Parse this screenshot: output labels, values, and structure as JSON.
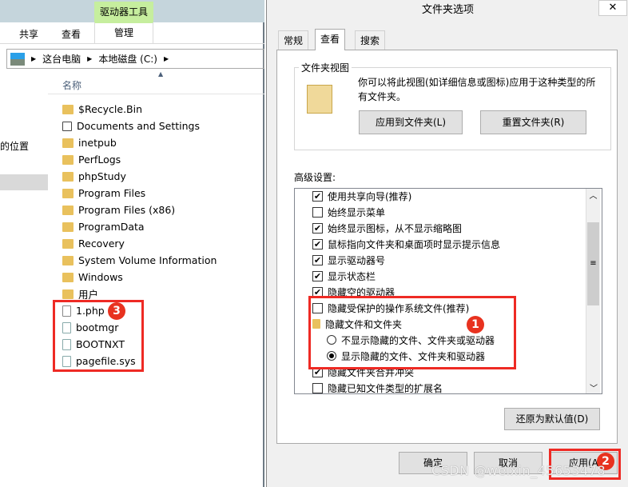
{
  "explorer": {
    "context_tab": "驱动器工具",
    "ribbon_tabs": [
      "共享",
      "查看",
      "管理"
    ],
    "breadcrumb": [
      "这台电脑",
      "本地磁盘 (C:)"
    ],
    "column_header": "名称",
    "nav_item": "的位置",
    "files": [
      {
        "name": "$Recycle.Bin",
        "icon": "folder-icon"
      },
      {
        "name": "Documents and Settings",
        "icon": "shortcut-folder-icon"
      },
      {
        "name": "inetpub",
        "icon": "folder-icon"
      },
      {
        "name": "PerfLogs",
        "icon": "folder-icon"
      },
      {
        "name": "phpStudy",
        "icon": "folder-icon"
      },
      {
        "name": "Program Files",
        "icon": "folder-icon"
      },
      {
        "name": "Program Files (x86)",
        "icon": "folder-icon"
      },
      {
        "name": "ProgramData",
        "icon": "folder-icon"
      },
      {
        "name": "Recovery",
        "icon": "folder-icon"
      },
      {
        "name": "System Volume Information",
        "icon": "folder-icon"
      },
      {
        "name": "Windows",
        "icon": "folder-icon"
      },
      {
        "name": "用户",
        "icon": "folder-icon"
      },
      {
        "name": "1.php",
        "icon": "file-icon"
      },
      {
        "name": "bootmgr",
        "icon": "system-file-icon"
      },
      {
        "name": "BOOTNXT",
        "icon": "system-file-icon"
      },
      {
        "name": "pagefile.sys",
        "icon": "system-file-icon"
      }
    ],
    "badge": "3"
  },
  "dialog": {
    "title": "文件夹选项",
    "close": "✕",
    "tabs": [
      "常规",
      "查看",
      "搜索"
    ],
    "active_tab": "查看",
    "folder_views": {
      "label": "文件夹视图",
      "description": "你可以将此视图(如详细信息或图标)应用于这种类型的所有文件夹。",
      "apply_button": "应用到文件夹(L)",
      "reset_button": "重置文件夹(R)"
    },
    "advanced_label": "高级设置:",
    "options": [
      {
        "type": "checkbox",
        "label": "使用共享向导(推荐)",
        "checked": true
      },
      {
        "type": "checkbox",
        "label": "始终显示菜单",
        "checked": false
      },
      {
        "type": "checkbox",
        "label": "始终显示图标，从不显示缩略图",
        "checked": true
      },
      {
        "type": "checkbox",
        "label": "鼠标指向文件夹和桌面项时显示提示信息",
        "checked": true
      },
      {
        "type": "checkbox",
        "label": "显示驱动器号",
        "checked": true
      },
      {
        "type": "checkbox",
        "label": "显示状态栏",
        "checked": true
      },
      {
        "type": "checkbox",
        "label": "隐藏空的驱动器",
        "checked": true
      },
      {
        "type": "checkbox",
        "label": "隐藏受保护的操作系统文件(推荐)",
        "checked": false
      },
      {
        "type": "group",
        "label": "隐藏文件和文件夹"
      },
      {
        "type": "radio",
        "label": "不显示隐藏的文件、文件夹或驱动器",
        "checked": false
      },
      {
        "type": "radio",
        "label": "显示隐藏的文件、文件夹和驱动器",
        "checked": true
      },
      {
        "type": "checkbox",
        "label": "隐藏文件夹合并冲突",
        "checked": true
      },
      {
        "type": "checkbox",
        "label": "隐藏已知文件类型的扩展名",
        "checked": false
      }
    ],
    "restore_button": "还原为默认值(D)",
    "ok_button": "确定",
    "cancel_button": "取消",
    "apply_button": "应用(A)",
    "badge_options": "1",
    "badge_apply": "2"
  },
  "watermark": "CSDN @weixin_45653478",
  "colors": {
    "annotation_red": "#ee2a24",
    "context_tab_green": "#c6ee9e"
  }
}
